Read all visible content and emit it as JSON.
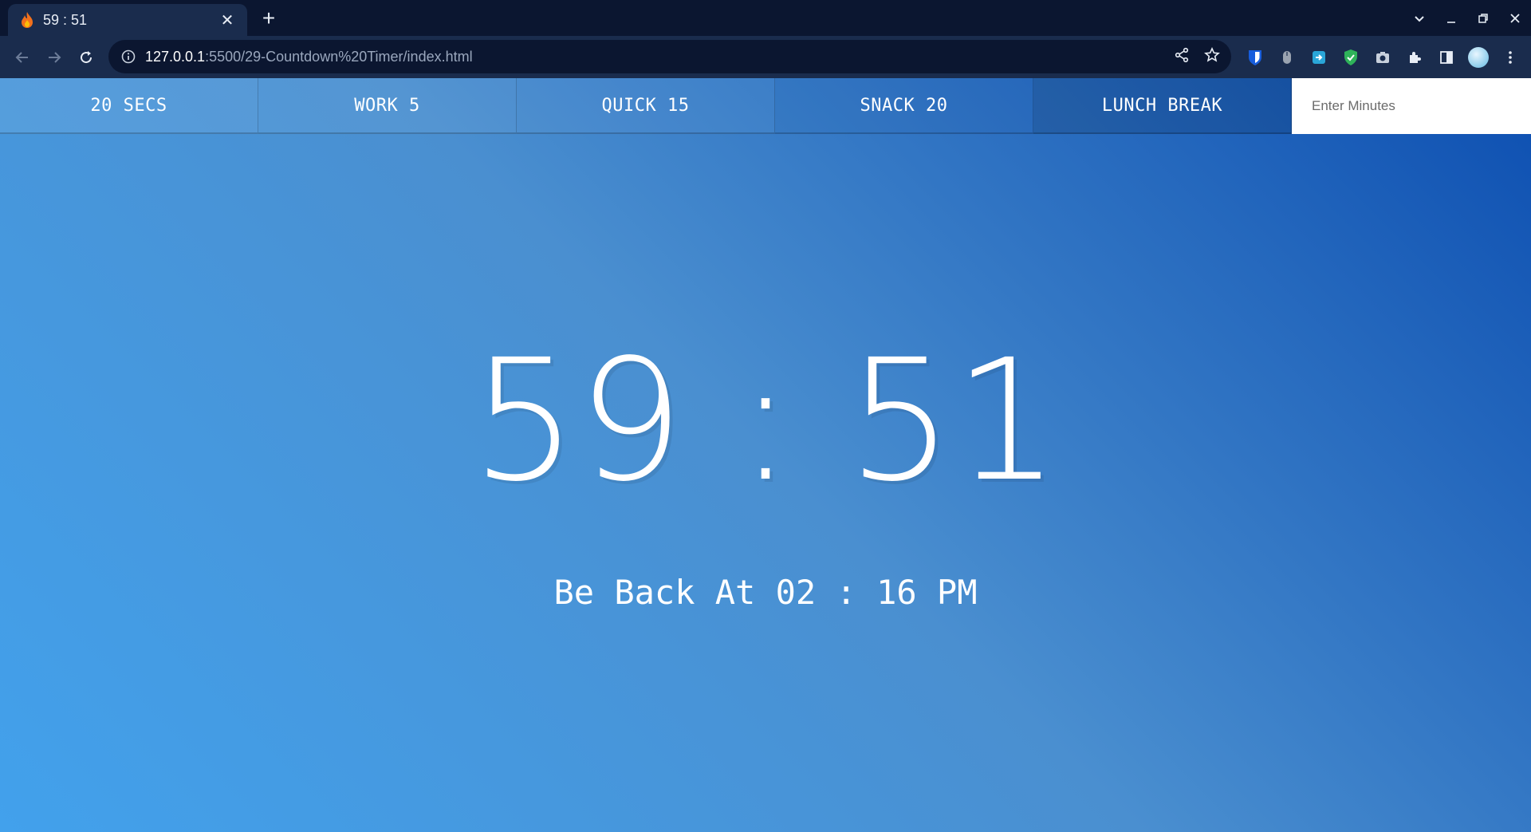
{
  "browser": {
    "tab": {
      "title": "59 : 51",
      "favicon": "fire-icon"
    },
    "url": {
      "host": "127.0.0.1",
      "path": ":5500/29-Countdown%20Timer/index.html"
    }
  },
  "timer": {
    "presets": [
      {
        "label": "20 SECS"
      },
      {
        "label": "WORK 5"
      },
      {
        "label": "QUICK 15"
      },
      {
        "label": "SNACK 20"
      },
      {
        "label": "LUNCH BREAK"
      }
    ],
    "custom_input_placeholder": "Enter Minutes",
    "display": "59 : 51",
    "end_time": "Be Back At 02 : 16 PM"
  },
  "colors": {
    "gradient_start": "#42a1ec",
    "gradient_end": "#0d4fb1",
    "text": "#ffffff"
  }
}
